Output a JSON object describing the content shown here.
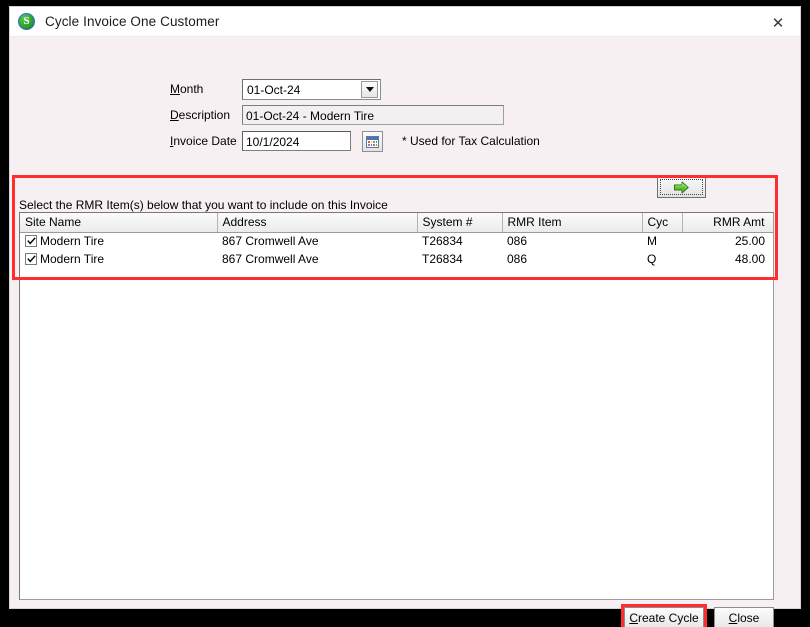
{
  "window": {
    "title": "Cycle Invoice One Customer",
    "app_icon": "app-logo-icon",
    "icon_letter": "S",
    "close_label": "✕"
  },
  "form": {
    "month": {
      "label_prefix": "",
      "label_accel": "M",
      "label_suffix": "onth",
      "value": "01-Oct-24",
      "options": [
        "01-Oct-24"
      ]
    },
    "description": {
      "label_accel": "D",
      "label_suffix": "escription",
      "value": "01-Oct-24 - Modern Tire",
      "placeholder": ""
    },
    "invoice_date": {
      "label_accel": "I",
      "label_suffix": "nvoice Date",
      "value": "10/1/2024",
      "placeholder": "",
      "calendar_icon": "calendar-icon"
    },
    "tax_note": "* Used for Tax Calculation"
  },
  "panel": {
    "arrow_button_icon": "green-right-arrow-icon",
    "instruction": "Select the RMR Item(s) below that you want to include on this Invoice"
  },
  "grid": {
    "columns": [
      {
        "key": "site_name",
        "label": "Site Name",
        "align": "left"
      },
      {
        "key": "address",
        "label": "Address",
        "align": "left"
      },
      {
        "key": "system",
        "label": "System #",
        "align": "left"
      },
      {
        "key": "rmr_item",
        "label": "RMR Item",
        "align": "left"
      },
      {
        "key": "cyc",
        "label": "Cyc",
        "align": "left"
      },
      {
        "key": "rmr_amt",
        "label": "RMR Amt",
        "align": "right"
      }
    ],
    "rows": [
      {
        "checked": true,
        "site_name": "Modern Tire",
        "address": "867 Cromwell Ave",
        "system": "T26834",
        "rmr_item": "086",
        "cyc": "M",
        "rmr_amt": "25.00"
      },
      {
        "checked": true,
        "site_name": "Modern Tire",
        "address": "867 Cromwell Ave",
        "system": "T26834",
        "rmr_item": "086",
        "cyc": "Q",
        "rmr_amt": "48.00"
      }
    ]
  },
  "footer": {
    "create_cycle": {
      "accel": "C",
      "rest": "reate Cycle"
    },
    "close": {
      "accel": "C",
      "rest": "lose"
    }
  },
  "colors": {
    "highlight": "#ff2d2d",
    "window_bg": "#f6f0f2",
    "titlebar_bg": "#ffffff",
    "grid_bg": "#ffffff",
    "accent_green": "#4caf2a"
  }
}
